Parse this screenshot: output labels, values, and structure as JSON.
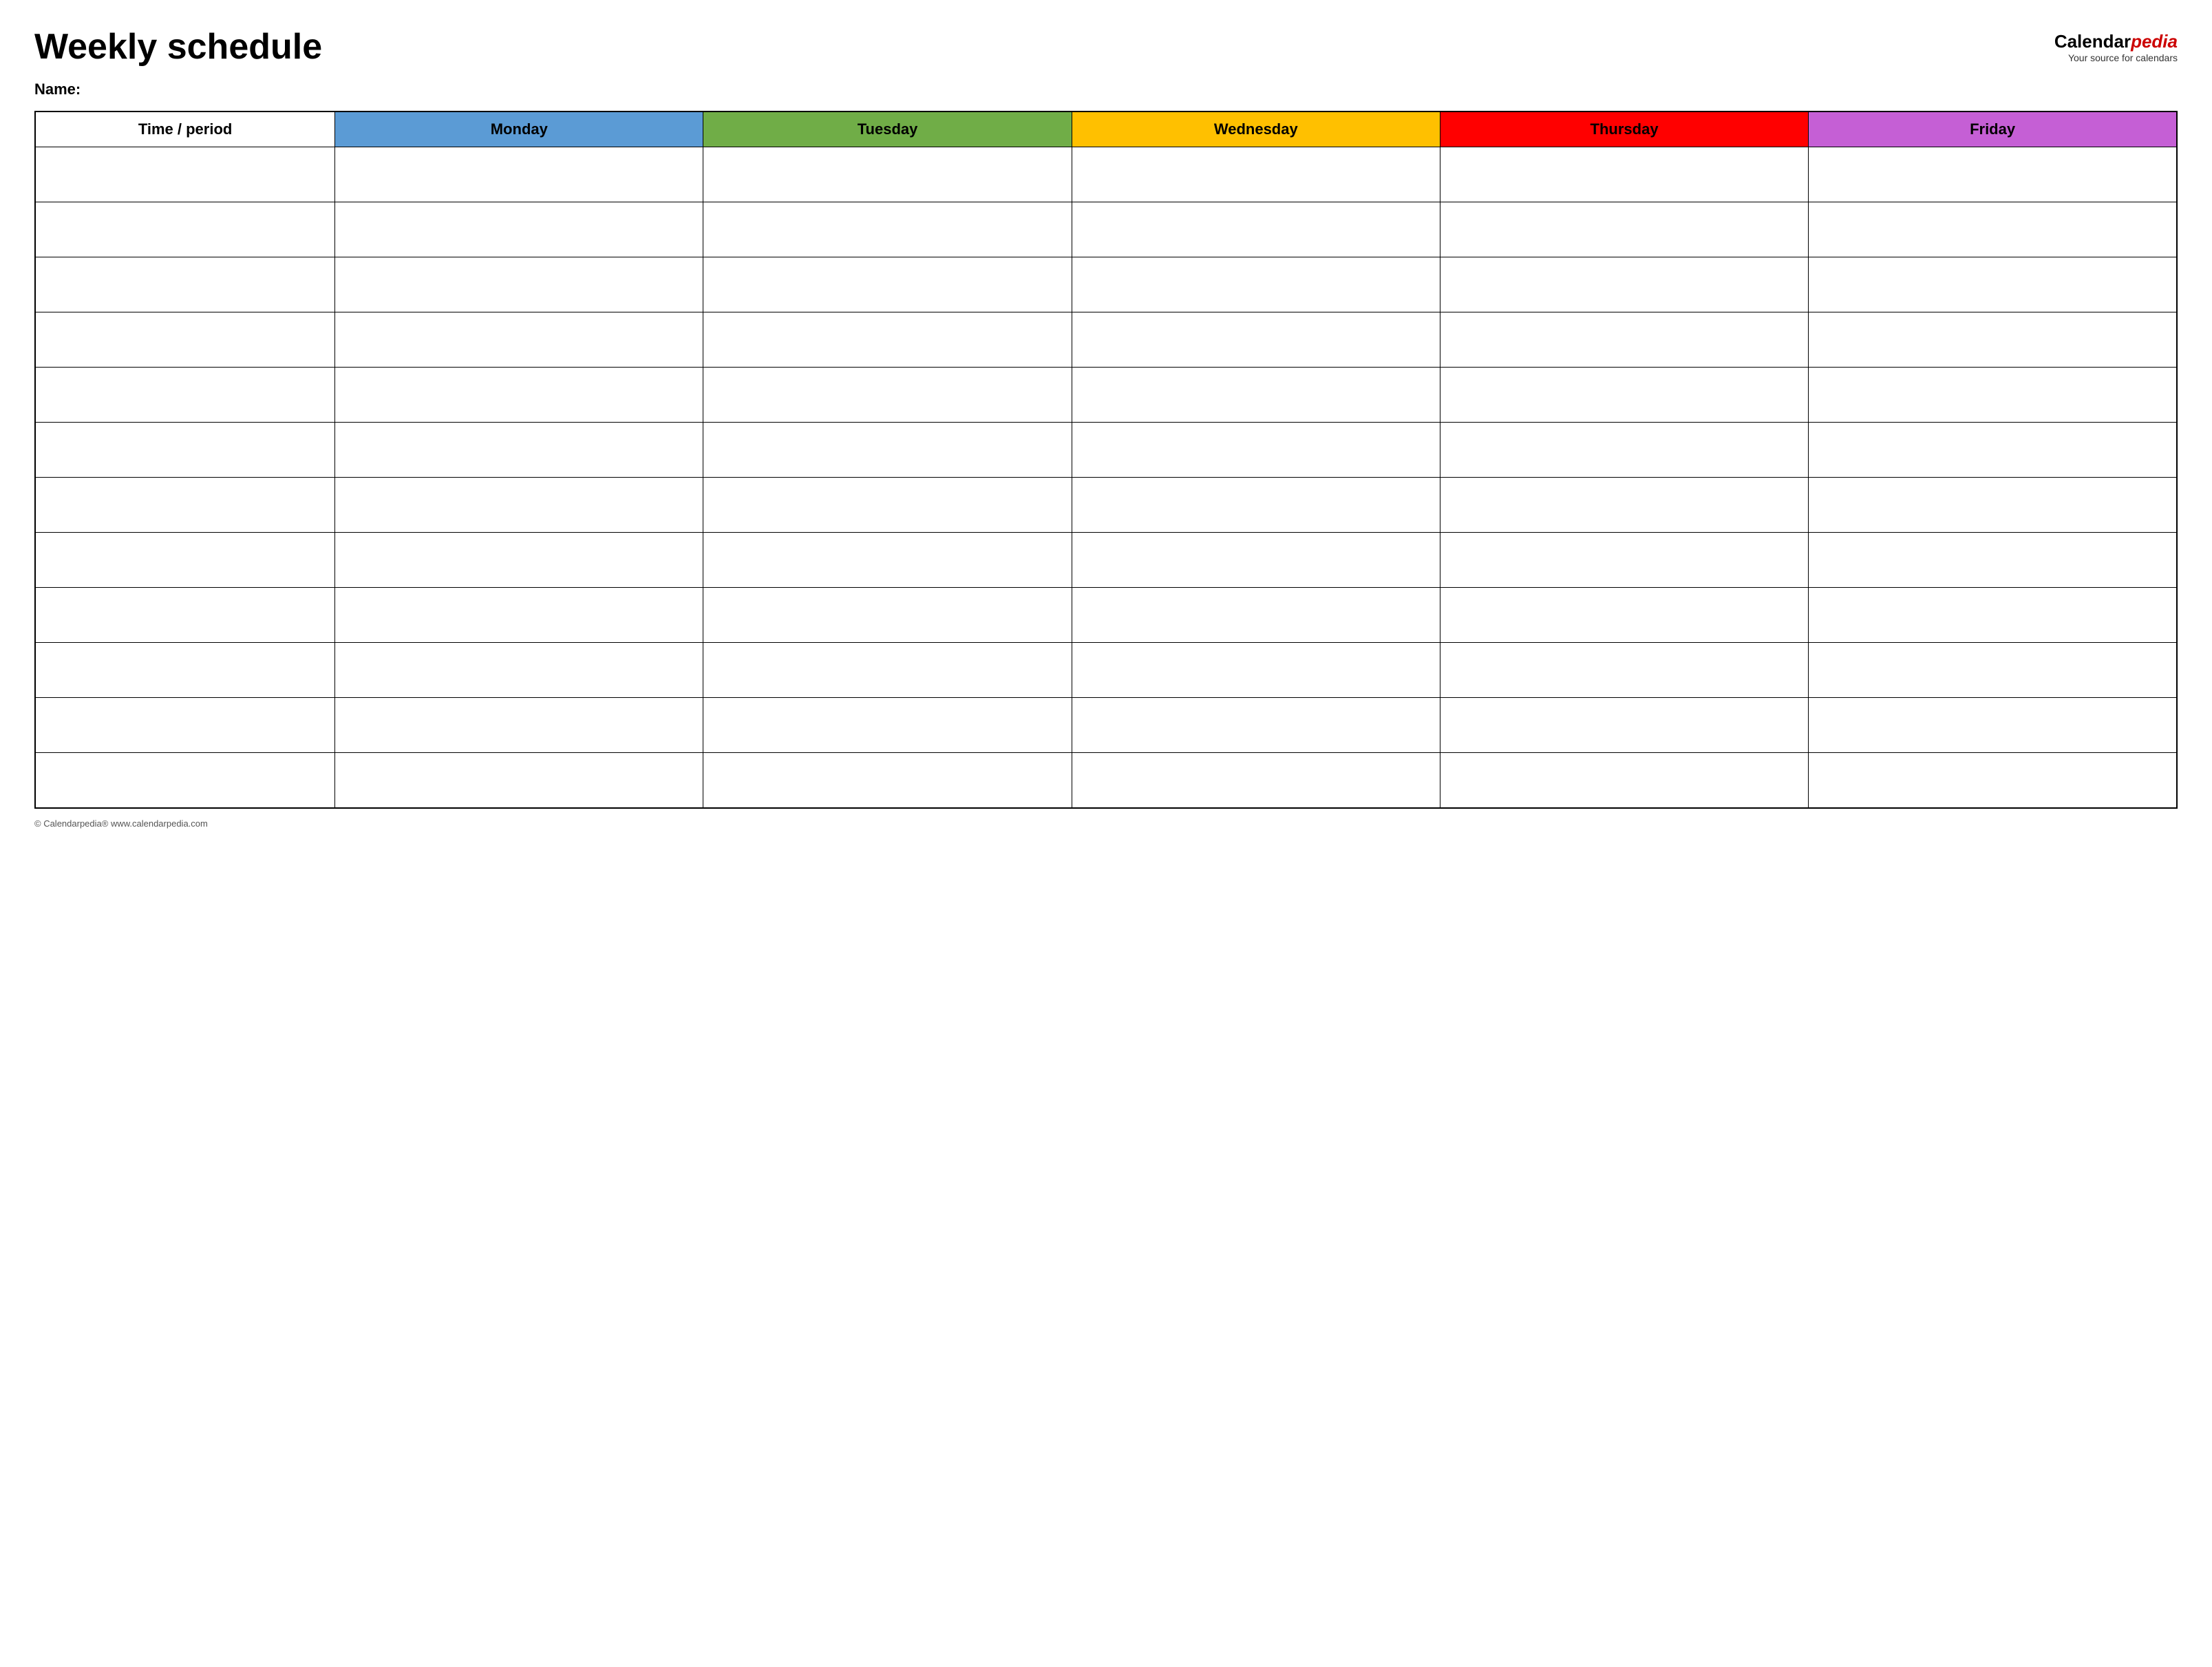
{
  "page": {
    "title": "Weekly schedule",
    "name_label": "Name:",
    "logo": {
      "calendar": "Calendar",
      "pedia": "pedia",
      "tagline": "Your source for calendars"
    },
    "footer": "© Calendarpedia®  www.calendarpedia.com"
  },
  "table": {
    "headers": [
      {
        "id": "time",
        "label": "Time / period",
        "color_class": "col-time"
      },
      {
        "id": "monday",
        "label": "Monday",
        "color_class": "col-monday"
      },
      {
        "id": "tuesday",
        "label": "Tuesday",
        "color_class": "col-tuesday"
      },
      {
        "id": "wednesday",
        "label": "Wednesday",
        "color_class": "col-wednesday"
      },
      {
        "id": "thursday",
        "label": "Thursday",
        "color_class": "col-thursday"
      },
      {
        "id": "friday",
        "label": "Friday",
        "color_class": "col-friday"
      }
    ],
    "row_count": 12
  }
}
